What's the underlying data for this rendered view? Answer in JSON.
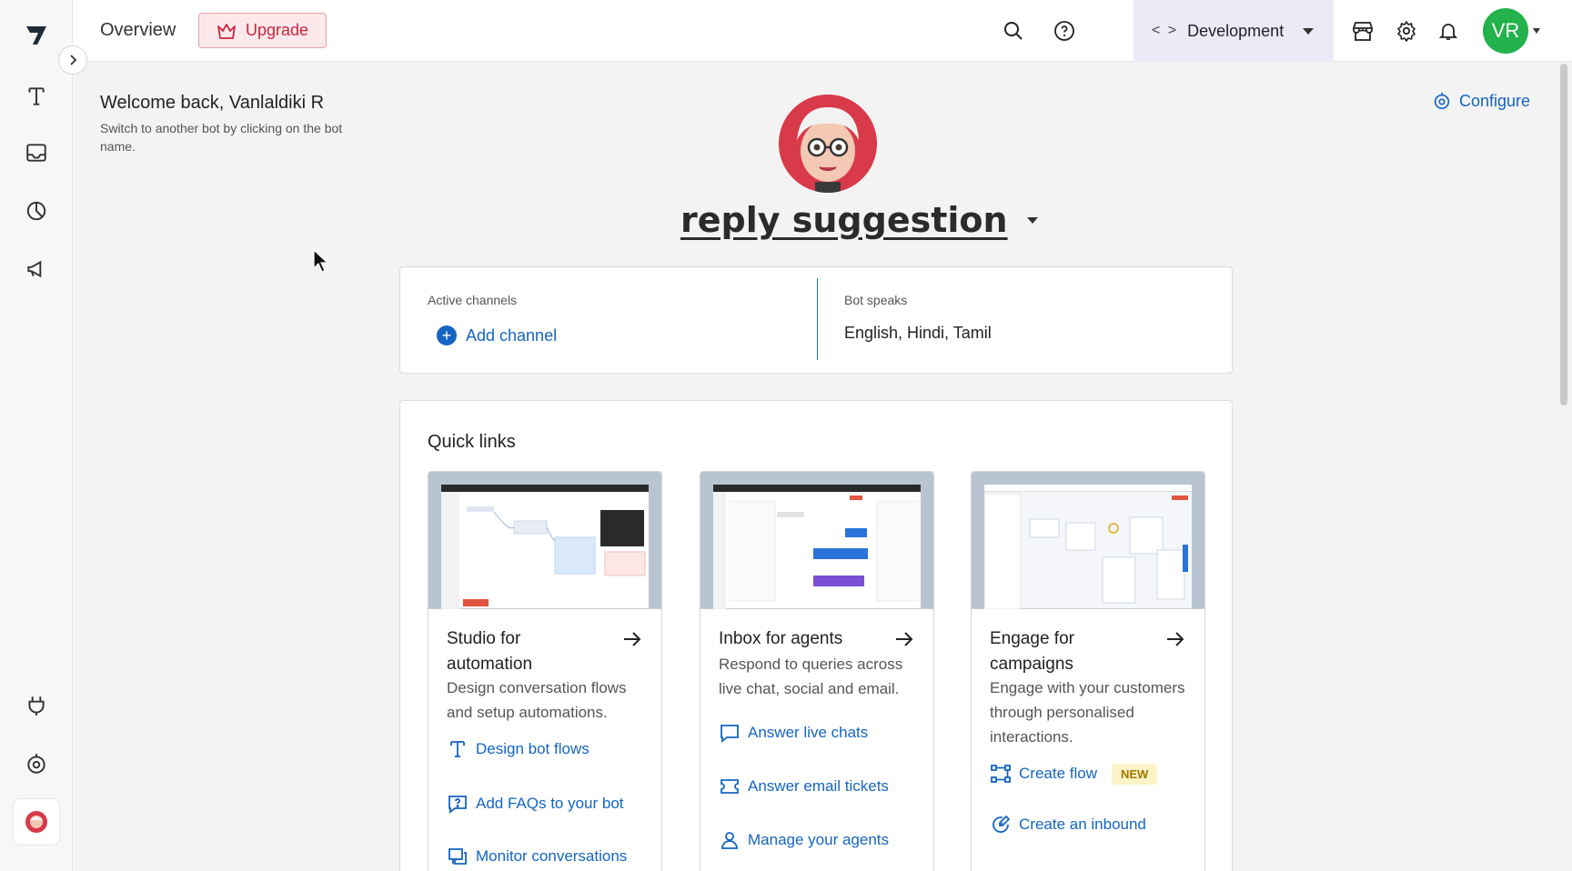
{
  "header": {
    "page_title": "Overview",
    "upgrade_label": "Upgrade",
    "environment": "Development",
    "user_initials": "VR"
  },
  "welcome": {
    "title": "Welcome back, Vanlaldiki R",
    "subtitle": "Switch to another bot by clicking on the bot name."
  },
  "configure_label": "Configure",
  "bot": {
    "name": "reply suggestion"
  },
  "channels": {
    "active_label": "Active channels",
    "add_label": "Add channel",
    "speaks_label": "Bot speaks",
    "languages": "English, Hindi, Tamil"
  },
  "quick_links": {
    "title": "Quick links",
    "cards": [
      {
        "title": "Studio for automation",
        "description": "Design conversation flows and setup automations.",
        "links": [
          "Design bot flows",
          "Add FAQs to your bot",
          "Monitor conversations"
        ]
      },
      {
        "title": "Inbox for agents",
        "description": "Respond to queries across live chat, social and email.",
        "links": [
          "Answer live chats",
          "Answer email tickets",
          "Manage your agents"
        ]
      },
      {
        "title": "Engage for campaigns",
        "description": "Engage with your customers through personalised interactions.",
        "links": [
          "Create flow",
          "Create an inbound"
        ],
        "badge": "NEW"
      }
    ]
  },
  "colors": {
    "accent": "#1565c0",
    "upgrade": "#c8283e",
    "avatar": "#23b24b",
    "env_bg": "#eee9f7"
  }
}
